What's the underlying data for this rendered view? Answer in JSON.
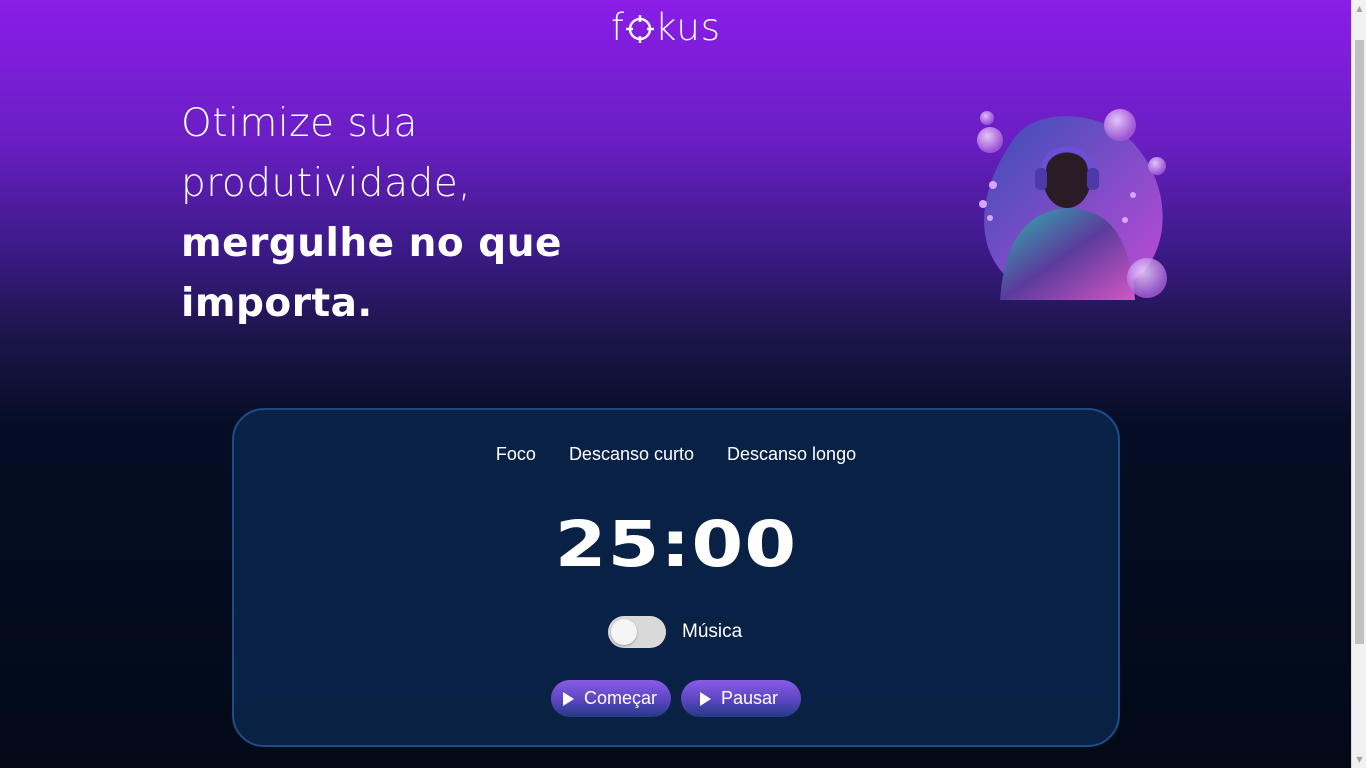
{
  "header": {
    "logo_text": "fokus",
    "logo_prefix": "f",
    "logo_suffix": "kus"
  },
  "hero": {
    "line1": "Otimize sua",
    "line2": "produtividade,",
    "line3": "mergulhe no que",
    "line4": "importa.",
    "image_icon": "person-with-headphones-illustration"
  },
  "timer_card": {
    "tabs": [
      {
        "label": "Foco"
      },
      {
        "label": "Descanso curto"
      },
      {
        "label": "Descanso longo"
      }
    ],
    "time": "25:00",
    "music": {
      "label": "Música",
      "enabled": false
    },
    "buttons": {
      "start": {
        "label": "Começar",
        "icon": "play-icon"
      },
      "pause": {
        "label": "Pausar",
        "icon": "play-icon"
      }
    }
  },
  "colors": {
    "gradient_top": "#8a1de8",
    "gradient_bottom": "#020a18",
    "card_bg": "#0c2850",
    "card_border": "#1e4d86",
    "button_top": "#8a5ce6",
    "button_bottom": "#233a86"
  }
}
